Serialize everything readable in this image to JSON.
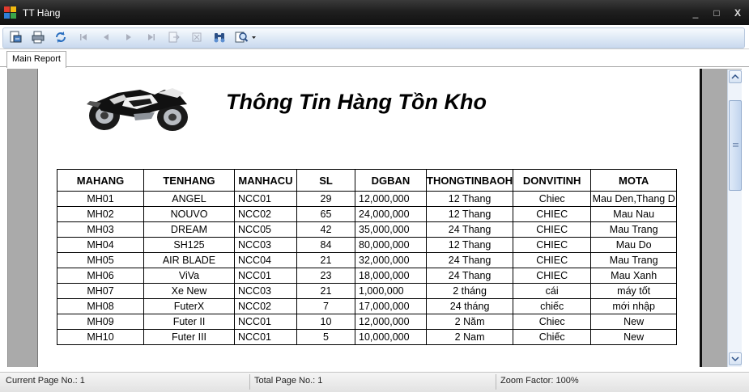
{
  "window": {
    "title": "TT Hàng",
    "controls": {
      "minimize": "_",
      "maximize": "□",
      "close": "X"
    }
  },
  "toolbar": {
    "buttons": [
      {
        "icon": "export-icon",
        "enabled": true
      },
      {
        "icon": "print-icon",
        "enabled": true
      },
      {
        "icon": "refresh-icon",
        "enabled": true
      },
      {
        "icon": "first-page-icon",
        "enabled": false
      },
      {
        "icon": "previous-page-icon",
        "enabled": false
      },
      {
        "icon": "next-page-icon",
        "enabled": false
      },
      {
        "icon": "last-page-icon",
        "enabled": false
      },
      {
        "icon": "go-to-page-icon",
        "enabled": false
      },
      {
        "icon": "stop-icon",
        "enabled": false
      },
      {
        "icon": "find-icon",
        "enabled": true
      },
      {
        "icon": "zoom-icon",
        "enabled": true
      }
    ]
  },
  "tabs": [
    {
      "label": "Main Report"
    }
  ],
  "report": {
    "title": "Thông Tin Hàng Tồn Kho",
    "columns": [
      "MAHANG",
      "TENHANG",
      "MANHACU",
      "SL",
      "DGBAN",
      "THONGTINBAOH",
      "DONVITINH",
      "MOTA"
    ],
    "rows": [
      [
        "MH01",
        "ANGEL",
        "NCC01",
        "29",
        "12,000,000",
        "12 Thang",
        "Chiec",
        "Mau Den,Thang D"
      ],
      [
        "MH02",
        "NOUVO",
        "NCC02",
        "65",
        "24,000,000",
        "12 Thang",
        "CHIEC",
        "Mau Nau"
      ],
      [
        "MH03",
        "DREAM",
        "NCC05",
        "42",
        "35,000,000",
        "24 Thang",
        "CHIEC",
        "Mau Trang"
      ],
      [
        "MH04",
        "SH125",
        "NCC03",
        "84",
        "80,000,000",
        "12 Thang",
        "CHIEC",
        "Mau Do"
      ],
      [
        "MH05",
        "AIR BLADE",
        "NCC04",
        "21",
        "32,000,000",
        "24 Thang",
        "CHIEC",
        "Mau Trang"
      ],
      [
        "MH06",
        "ViVa",
        "NCC01",
        "23",
        "18,000,000",
        "24 Thang",
        "CHIEC",
        "Mau Xanh"
      ],
      [
        "MH07",
        "Xe New",
        "NCC03",
        "21",
        "1,000,000",
        "2 tháng",
        "cái",
        "máy tốt"
      ],
      [
        "MH08",
        "FuterX",
        "NCC02",
        "7",
        "17,000,000",
        "24 tháng",
        "chiếc",
        "mới nhập"
      ],
      [
        "MH09",
        "Futer II",
        "NCC01",
        "10",
        "12,000,000",
        "2 Năm",
        "Chiec",
        "New"
      ],
      [
        "MH10",
        "Futer III",
        "NCC01",
        "5",
        "10,000,000",
        "2 Nam",
        "Chiếc",
        "New"
      ]
    ]
  },
  "statusbar": {
    "current_page": "Current Page No.: 1",
    "total_page": "Total Page No.: 1",
    "zoom": "Zoom Factor: 100%"
  },
  "colors": {
    "titlebar": "#1f1f1f",
    "toolbar": "#dde8f5",
    "viewport_bg": "#aaaaaa",
    "page_bg": "#ffffff"
  }
}
